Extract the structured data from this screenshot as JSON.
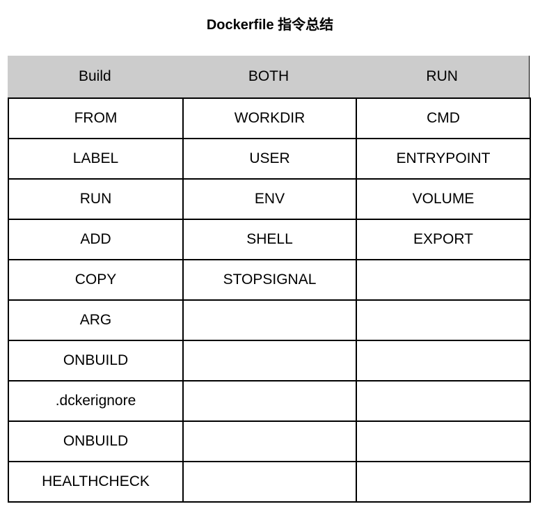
{
  "title": "Dockerfile 指令总结",
  "table": {
    "headers": [
      "Build",
      "BOTH",
      "RUN"
    ],
    "rows": [
      [
        "FROM",
        "WORKDIR",
        "CMD"
      ],
      [
        "LABEL",
        "USER",
        "ENTRYPOINT"
      ],
      [
        "RUN",
        "ENV",
        "VOLUME"
      ],
      [
        "ADD",
        "SHELL",
        "EXPORT"
      ],
      [
        "COPY",
        "STOPSIGNAL",
        ""
      ],
      [
        "ARG",
        "",
        ""
      ],
      [
        "ONBUILD",
        "",
        ""
      ],
      [
        ".dckerignore",
        "",
        ""
      ],
      [
        "ONBUILD",
        "",
        ""
      ],
      [
        "HEALTHCHECK",
        "",
        ""
      ]
    ]
  }
}
